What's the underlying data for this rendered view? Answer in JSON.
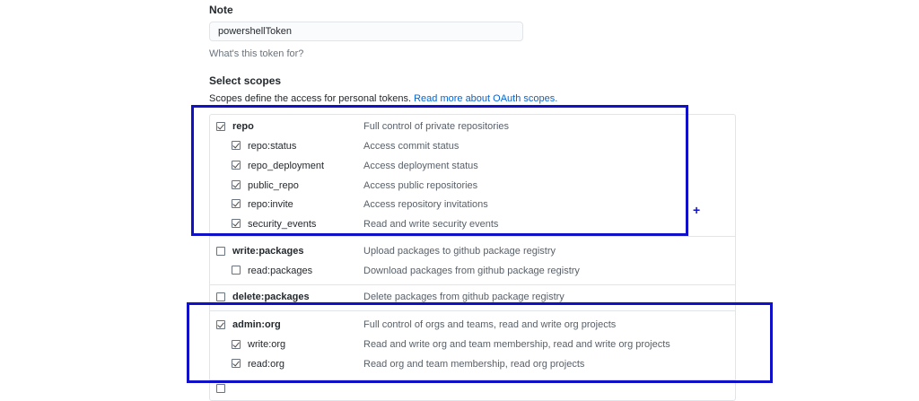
{
  "note": {
    "label": "Note",
    "value": "powershellToken",
    "help": "What's this token for?"
  },
  "scopes": {
    "heading": "Select scopes",
    "intro": "Scopes define the access for personal tokens.",
    "read_more_link": "Read more about OAuth scopes."
  },
  "scope_list": {
    "repo": {
      "name": "repo",
      "desc": "Full control of private repositories",
      "checked": true
    },
    "repo_status": {
      "name": "repo:status",
      "desc": "Access commit status",
      "checked": true
    },
    "repo_deployment": {
      "name": "repo_deployment",
      "desc": "Access deployment status",
      "checked": true
    },
    "public_repo": {
      "name": "public_repo",
      "desc": "Access public repositories",
      "checked": true
    },
    "repo_invite": {
      "name": "repo:invite",
      "desc": "Access repository invitations",
      "checked": true
    },
    "security_events": {
      "name": "security_events",
      "desc": "Read and write security events",
      "checked": true
    },
    "write_packages": {
      "name": "write:packages",
      "desc": "Upload packages to github package registry",
      "checked": false
    },
    "read_packages": {
      "name": "read:packages",
      "desc": "Download packages from github package registry",
      "checked": false
    },
    "delete_packages": {
      "name": "delete:packages",
      "desc": "Delete packages from github package registry",
      "checked": false
    },
    "admin_org": {
      "name": "admin:org",
      "desc": "Full control of orgs and teams, read and write org projects",
      "checked": true
    },
    "write_org": {
      "name": "write:org",
      "desc": "Read and write org and team membership, read and write org projects",
      "checked": true
    },
    "read_org": {
      "name": "read:org",
      "desc": "Read org and team membership, read org projects",
      "checked": true
    }
  },
  "annotation": {
    "plus_symbol": "+",
    "highlight_color": "#1010c8"
  }
}
